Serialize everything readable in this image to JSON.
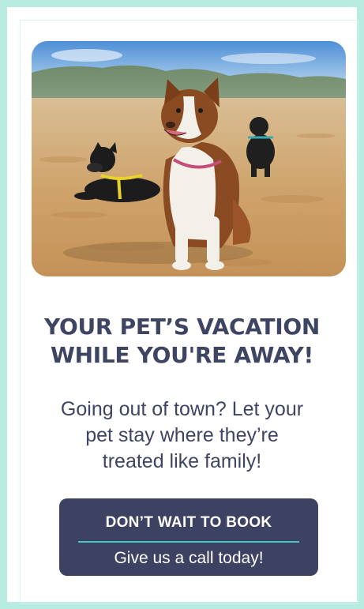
{
  "colors": {
    "frame_border": "#b9ece0",
    "text_primary": "#3e4563",
    "button_bg": "#3e4262",
    "button_divider": "#43c7bd",
    "button_text": "#ffffff"
  },
  "hero_image": {
    "icon": "dogs-on-beach-photo"
  },
  "headline": {
    "line1": "YOUR PET’S VACATION",
    "line2": "WHILE YOU'RE AWAY!"
  },
  "subtext": {
    "line1": "Going out of town? Let your",
    "line2": "pet stay where they’re",
    "line3": "treated like family!"
  },
  "cta": {
    "title": "DON’T WAIT TO BOOK",
    "subtitle": "Give us a call today!"
  }
}
